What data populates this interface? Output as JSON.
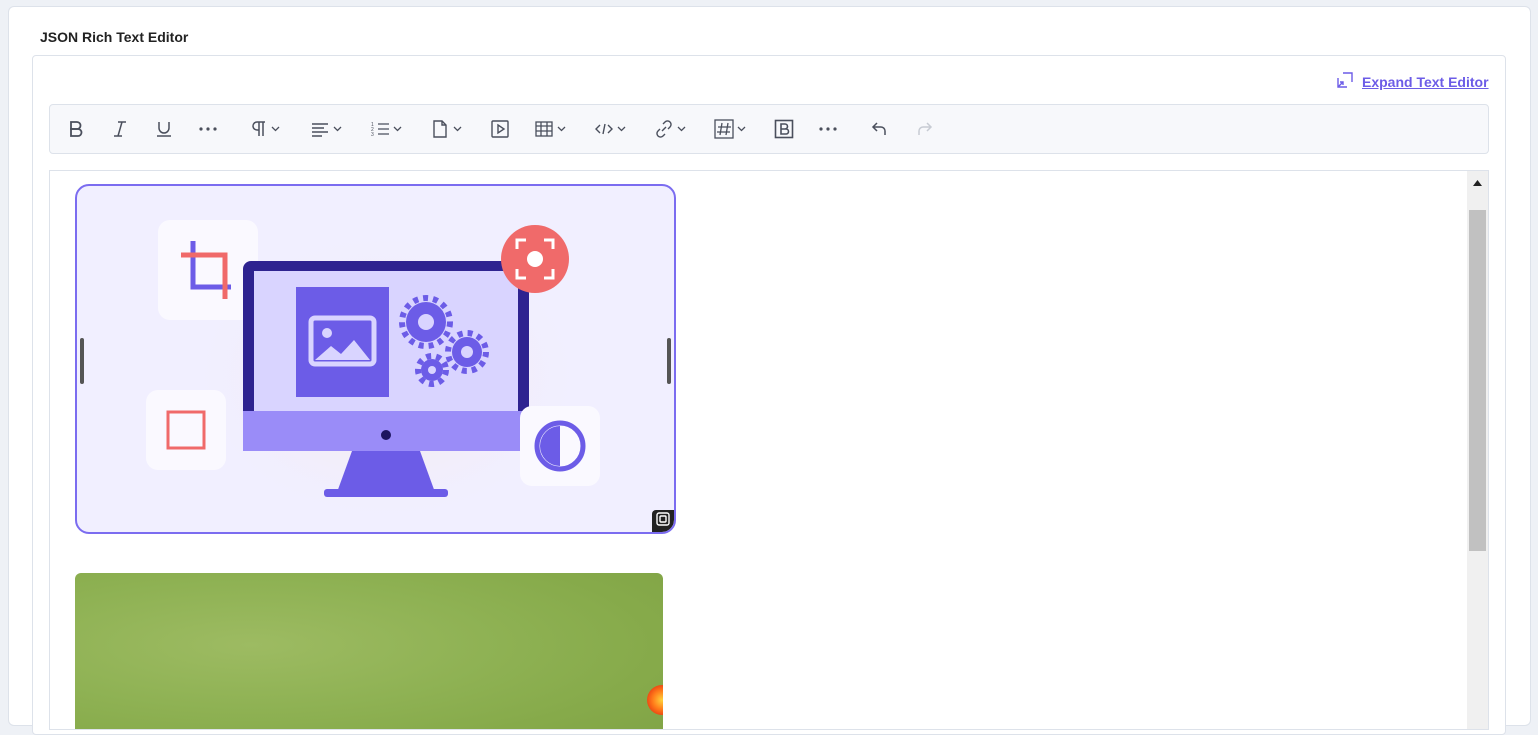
{
  "field": {
    "label": "JSON Rich Text Editor"
  },
  "expand_link": {
    "label": "Expand Text Editor",
    "icon": "expand-icon"
  },
  "toolbar": {
    "items": [
      {
        "name": "bold-button",
        "icon": "bold-icon"
      },
      {
        "name": "italic-button",
        "icon": "italic-icon"
      },
      {
        "name": "underline-button",
        "icon": "underline-icon"
      },
      {
        "name": "more-format-button",
        "icon": "ellipsis-icon"
      },
      {
        "name": "paragraph-dropdown",
        "icon": "pilcrow-icon"
      },
      {
        "name": "align-dropdown",
        "icon": "align-left-icon"
      },
      {
        "name": "list-dropdown",
        "icon": "ordered-list-icon"
      },
      {
        "name": "reference-dropdown",
        "icon": "document-icon"
      },
      {
        "name": "embed-video-button",
        "icon": "play-icon"
      },
      {
        "name": "table-dropdown",
        "icon": "table-icon"
      },
      {
        "name": "code-dropdown",
        "icon": "code-icon"
      },
      {
        "name": "link-dropdown",
        "icon": "link-icon"
      },
      {
        "name": "hashtag-dropdown",
        "icon": "hashtag-icon"
      },
      {
        "name": "block-button",
        "icon": "block-icon"
      },
      {
        "name": "more-tools-button",
        "icon": "ellipsis-icon"
      },
      {
        "name": "undo-button",
        "icon": "undo-icon"
      },
      {
        "name": "redo-button",
        "icon": "redo-icon"
      }
    ]
  },
  "colors": {
    "accent": "#6c5ce7",
    "border": "#dde2ea",
    "image_selected_border": "#7b6cf0",
    "illustration_purple": "#6c5ce7",
    "illustration_coral": "#f06a6a"
  },
  "content": {
    "images": [
      {
        "kind": "illustration",
        "depicts": "monitor with image settings icons",
        "selected": true
      },
      {
        "kind": "photo",
        "depicts": "green meadow with flower"
      }
    ]
  }
}
